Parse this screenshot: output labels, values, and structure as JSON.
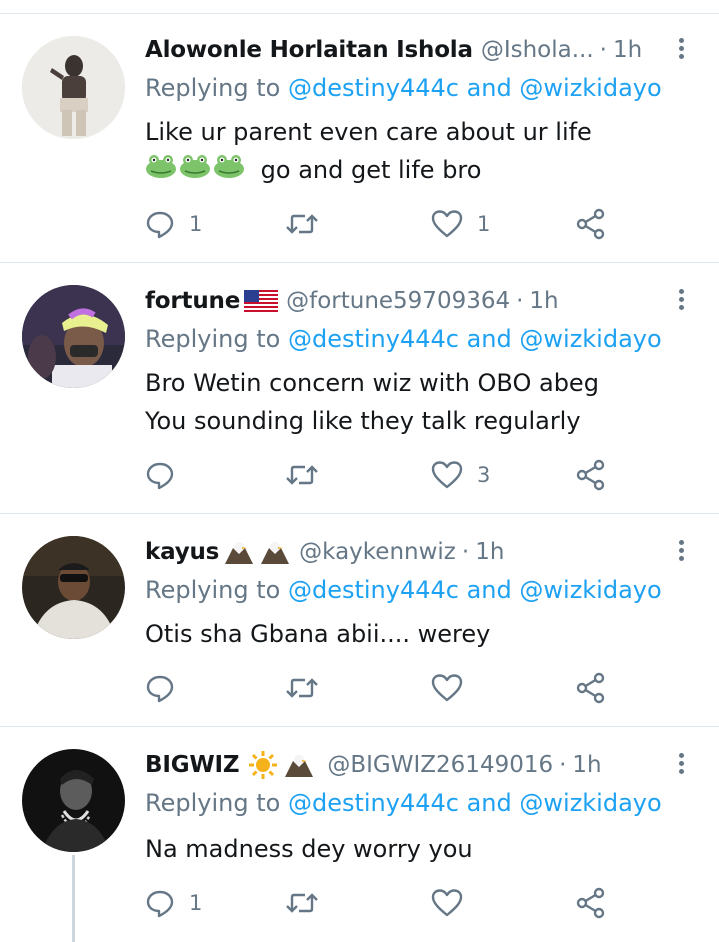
{
  "colors": {
    "accent": "#1da1f2",
    "muted": "#657786",
    "text": "#14171a",
    "divider": "#e1e8ed"
  },
  "replies": [
    {
      "display_name": "Alowonle Horlaitan Ishola",
      "name_emojis": [],
      "handle": "@Ishola...",
      "separator": "·",
      "time": "1h",
      "replying_prefix": "Replying to",
      "mention_1": "@destiny444c",
      "joiner": "and",
      "mention_2": "@wizkidayo",
      "text_line_1": "Like ur parent even care about ur life",
      "text_line_2": "go and get life bro",
      "text_emojis": [
        "frog-face",
        "frog-face",
        "frog-face"
      ],
      "reply_count": "1",
      "like_count": "1"
    },
    {
      "display_name": "fortune",
      "name_emojis": [
        "us-flag"
      ],
      "handle": "@fortune59709364",
      "separator": "·",
      "time": "1h",
      "replying_prefix": "Replying to",
      "mention_1": "@destiny444c",
      "joiner": "and",
      "mention_2": "@wizkidayo",
      "text_line_1": "Bro Wetin concern wiz with OBO abeg",
      "text_line_2": "You sounding like they talk regularly",
      "reply_count": "",
      "like_count": "3"
    },
    {
      "display_name": "kayus",
      "name_emojis": [
        "eagle",
        "eagle"
      ],
      "handle": "@kaykennwiz",
      "separator": "·",
      "time": "1h",
      "replying_prefix": "Replying to",
      "mention_1": "@destiny444c",
      "joiner": "and",
      "mention_2": "@wizkidayo",
      "text_line_1": "Otis sha Gbana abii.... werey",
      "text_line_2": "",
      "reply_count": "",
      "like_count": ""
    },
    {
      "display_name": "BIGWIZ",
      "name_emojis": [
        "sun",
        "eagle"
      ],
      "handle": "@BIGWIZ26149016",
      "separator": "·",
      "time": "1h",
      "replying_prefix": "Replying to",
      "mention_1": "@destiny444c",
      "joiner": "and",
      "mention_2": "@wizkidayo",
      "text_line_1": "Na madness dey worry you",
      "text_line_2": "",
      "reply_count": "1",
      "like_count": ""
    }
  ],
  "icons": {
    "reply": "reply-bubble-icon",
    "retweet": "retweet-icon",
    "like": "heart-icon",
    "share": "share-icon",
    "more": "more-vertical-icon"
  }
}
